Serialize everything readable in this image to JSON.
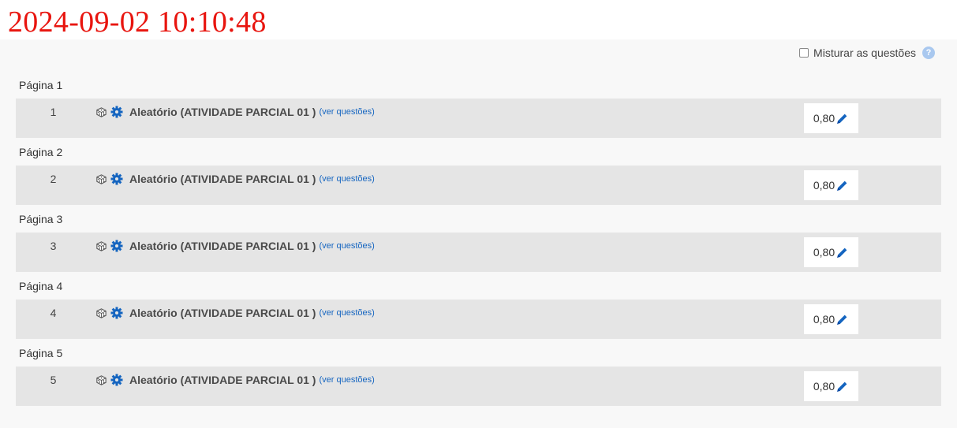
{
  "timestamp": "2024-09-02 10:10:48",
  "shuffle": {
    "label": "Misturar as questões",
    "checked": false,
    "help_symbol": "?"
  },
  "pages": [
    {
      "label": "Página 1",
      "slot": "1",
      "question": "Aleatório (ATIVIDADE PARCIAL 01 )",
      "link": "(ver questões)",
      "grade": "0,80"
    },
    {
      "label": "Página 2",
      "slot": "2",
      "question": "Aleatório (ATIVIDADE PARCIAL 01 )",
      "link": "(ver questões)",
      "grade": "0,80"
    },
    {
      "label": "Página 3",
      "slot": "3",
      "question": "Aleatório (ATIVIDADE PARCIAL 01 )",
      "link": "(ver questões)",
      "grade": "0,80"
    },
    {
      "label": "Página 4",
      "slot": "4",
      "question": "Aleatório (ATIVIDADE PARCIAL 01 )",
      "link": "(ver questões)",
      "grade": "0,80"
    },
    {
      "label": "Página 5",
      "slot": "5",
      "question": "Aleatório (ATIVIDADE PARCIAL 01 )",
      "link": "(ver questões)",
      "grade": "0,80"
    }
  ],
  "colors": {
    "accent": "#1565c0",
    "timestamp": "#e8150f"
  },
  "icons": {
    "dice": "dice-icon",
    "gear": "gear-icon",
    "pencil": "pencil-icon",
    "help": "help-icon"
  }
}
